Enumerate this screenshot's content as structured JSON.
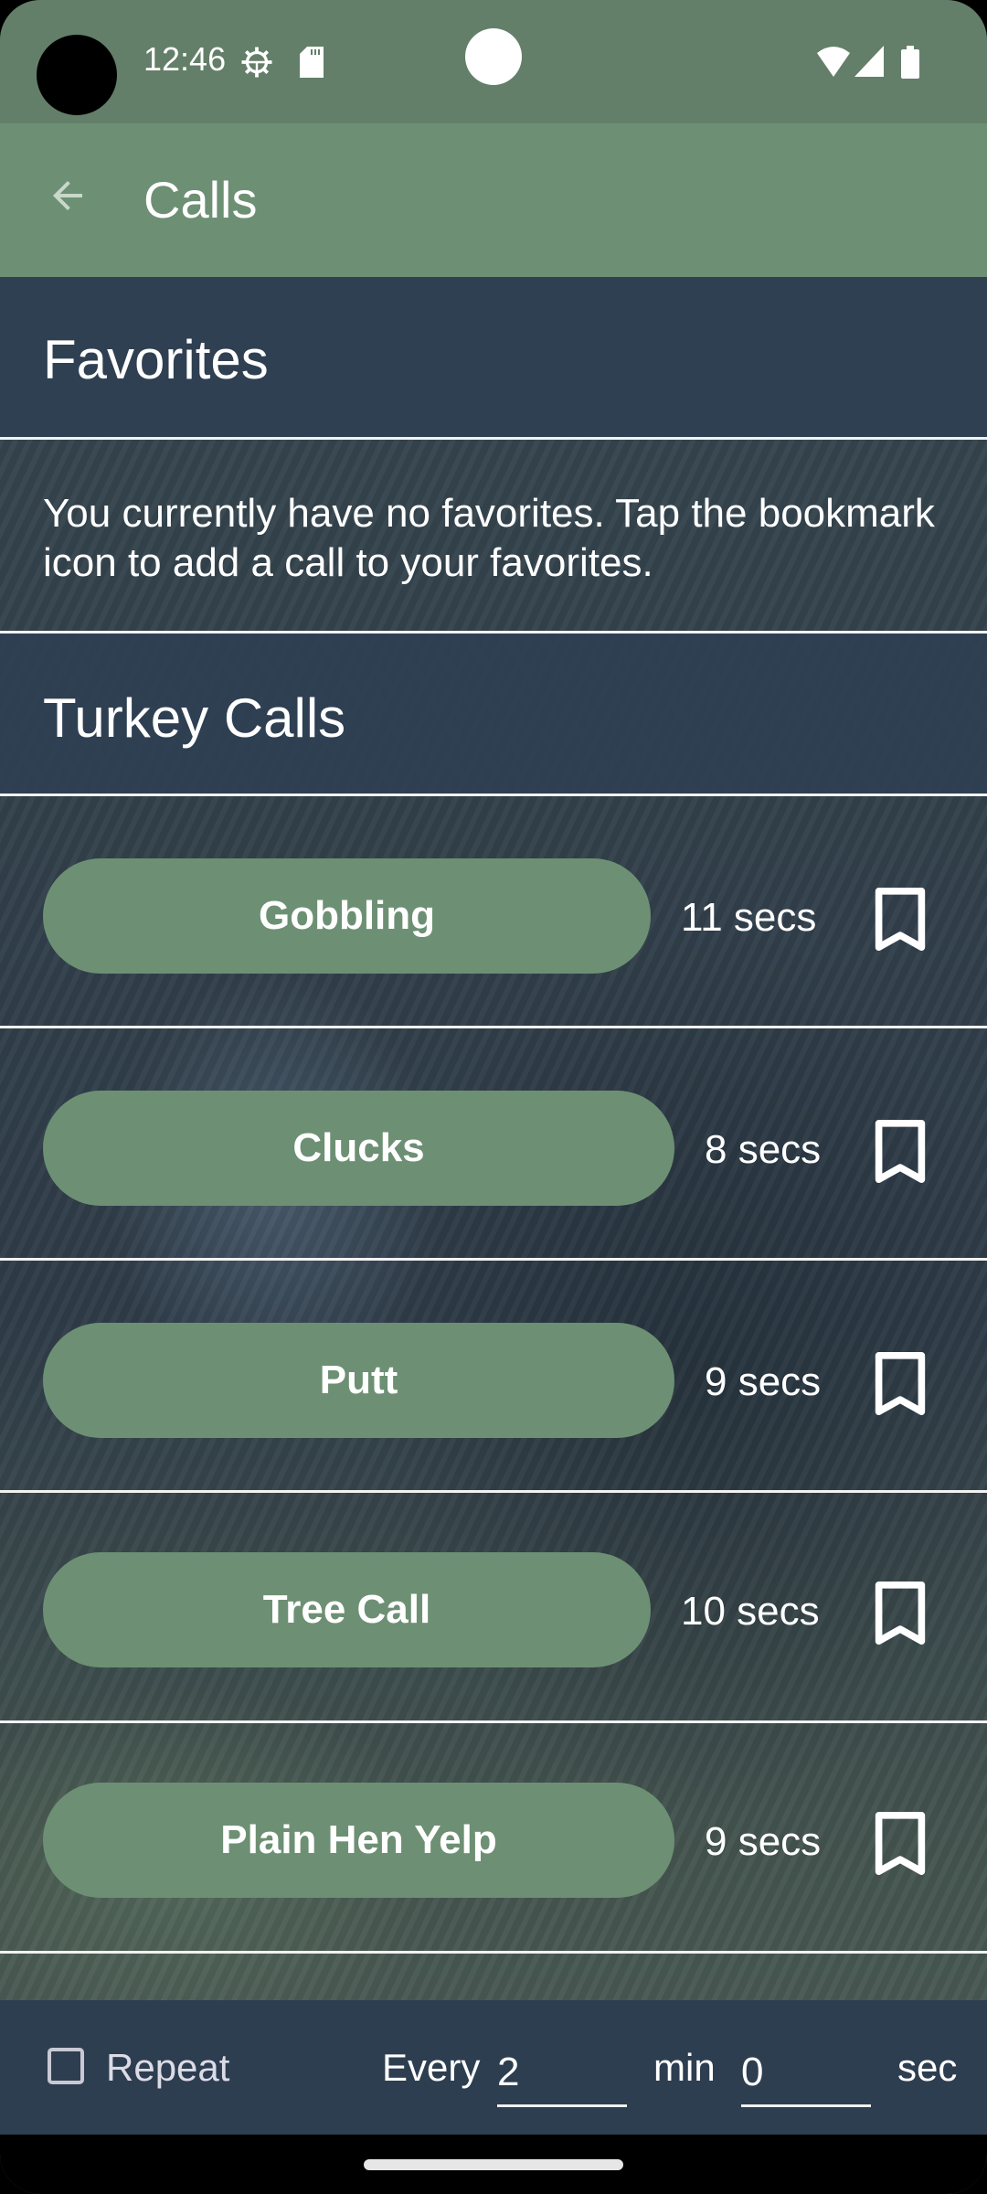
{
  "status_bar": {
    "time": "12:46",
    "icons": [
      "settings-gear-icon",
      "sd-card-icon",
      "wifi-icon",
      "cell-signal-icon",
      "battery-icon"
    ]
  },
  "app_bar": {
    "back_icon": "arrow-left-icon",
    "title": "Calls"
  },
  "favorites": {
    "title": "Favorites",
    "empty_message": "You currently have no favorites. Tap the bookmark icon to add a call to your favorites."
  },
  "turkey_calls": {
    "title": "Turkey Calls",
    "calls": [
      {
        "name": "Gobbling",
        "duration": "11 secs",
        "bookmarked": false
      },
      {
        "name": "Clucks",
        "duration": "8 secs",
        "bookmarked": false
      },
      {
        "name": "Putt",
        "duration": "9 secs",
        "bookmarked": false
      },
      {
        "name": "Tree Call",
        "duration": "10 secs",
        "bookmarked": false
      },
      {
        "name": "Plain Hen Yelp",
        "duration": "9 secs",
        "bookmarked": false
      }
    ]
  },
  "footer": {
    "repeat_label": "Repeat",
    "repeat_checked": false,
    "every_label": "Every",
    "minutes_value": "2",
    "min_label": "min",
    "seconds_value": "0",
    "sec_label": "sec"
  },
  "colors": {
    "status_bar": "#647f69",
    "app_bar": "#6d9074",
    "button": "#6d9074",
    "section_header": "#2e4053",
    "footer": "#2e3e51"
  }
}
